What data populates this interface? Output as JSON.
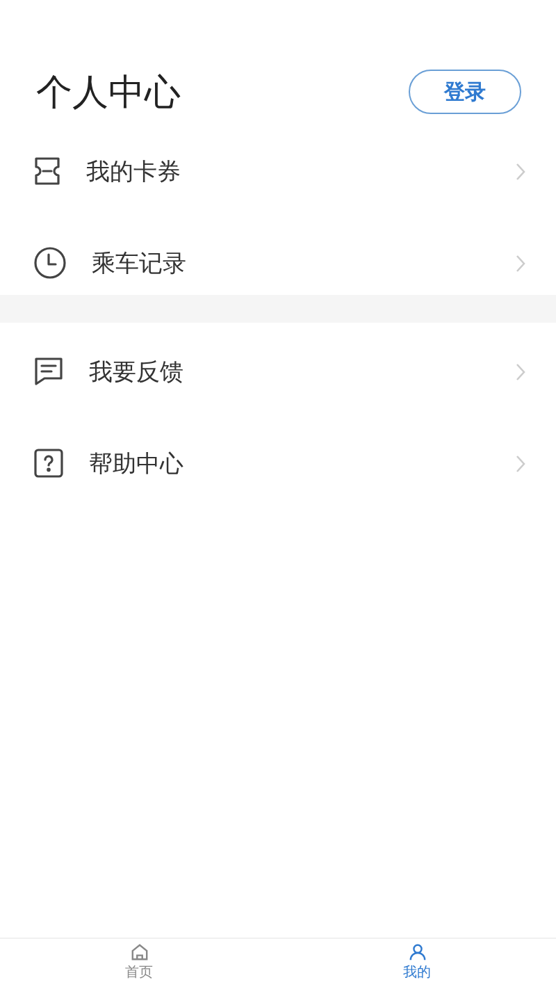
{
  "header": {
    "title": "个人中心",
    "login_button": "登录"
  },
  "sections": [
    {
      "items": [
        {
          "kind": "ticket",
          "label": "我的卡券"
        },
        {
          "kind": "clock",
          "label": "乘车记录"
        }
      ]
    },
    {
      "items": [
        {
          "kind": "feedback",
          "label": "我要反馈"
        },
        {
          "kind": "help",
          "label": "帮助中心"
        }
      ]
    }
  ],
  "tab_bar": [
    {
      "kind": "home",
      "label": "首页",
      "selected": false
    },
    {
      "kind": "profile",
      "label": "我的",
      "selected": true
    }
  ]
}
